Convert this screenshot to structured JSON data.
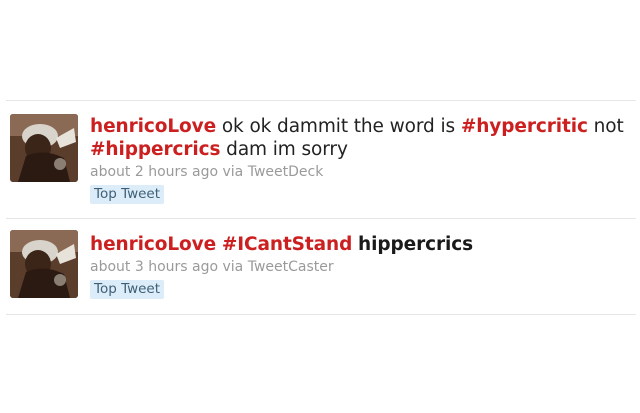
{
  "colors": {
    "accent": "#cc1f1f",
    "meta_text": "#9a9a9a",
    "badge_bg": "#dcedf9",
    "badge_text": "#3f5f77"
  },
  "tweets": [
    {
      "screen_name": "henricoLove",
      "text_1": " ok ok dammit the word is ",
      "hashtag_1": "#hypercritic",
      "text_2": " not",
      "hashtag_2": "#hippercrics",
      "text_3": " dam im sorry",
      "time": "about 2 hours ago",
      "via": " via ",
      "source": "TweetDeck",
      "badge": "Top Tweet",
      "avatar_icon": "user-avatar"
    },
    {
      "screen_name": "henricoLove",
      "hashtag_1": "#ICantStand",
      "text_1": "hippercrics",
      "time": "about 3 hours ago",
      "via": " via ",
      "source": "TweetCaster",
      "badge": "Top Tweet",
      "avatar_icon": "user-avatar"
    }
  ]
}
